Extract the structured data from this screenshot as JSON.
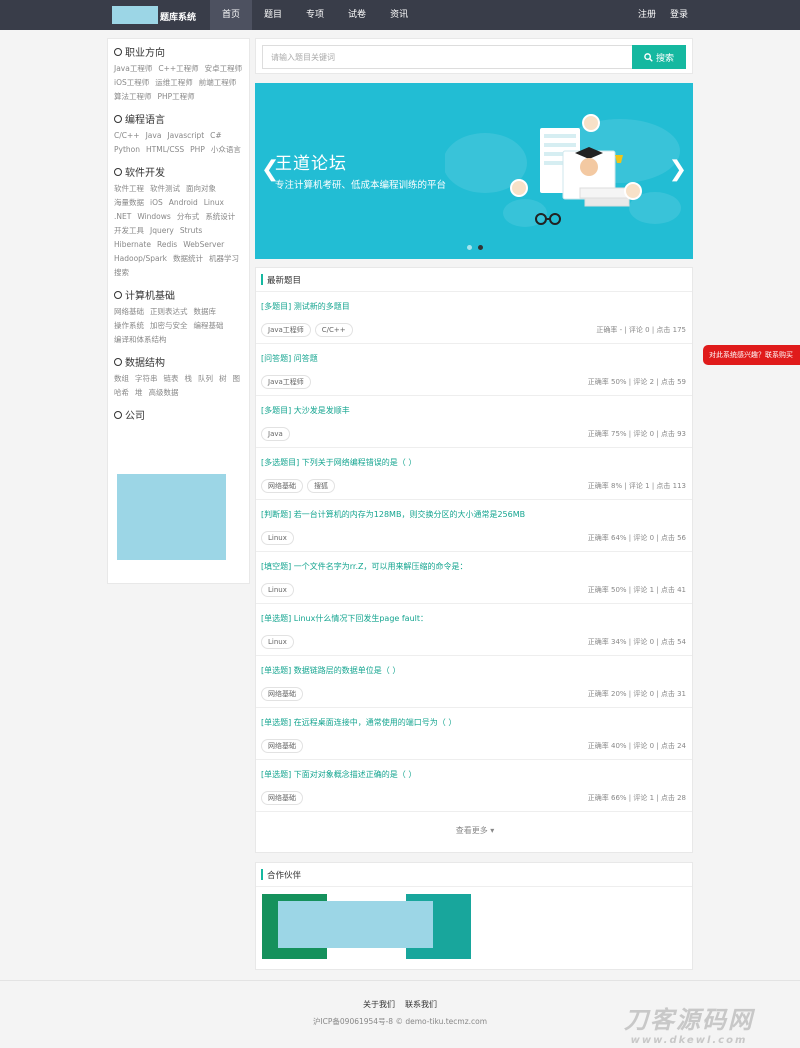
{
  "header": {
    "logo_text": "题库系统",
    "nav": [
      "首页",
      "题目",
      "专项",
      "试卷",
      "资讯"
    ],
    "register": "注册",
    "login": "登录"
  },
  "sidebar": {
    "categories": [
      {
        "title": "职业方向",
        "tags": [
          "Java工程师",
          "C++工程师",
          "安卓工程师",
          "iOS工程师",
          "运维工程师",
          "前端工程师",
          "算法工程师",
          "PHP工程师"
        ]
      },
      {
        "title": "编程语言",
        "tags": [
          "C/C++",
          "Java",
          "Javascript",
          "C#",
          "Python",
          "HTML/CSS",
          "PHP",
          "小众语言"
        ]
      },
      {
        "title": "软件开发",
        "tags": [
          "软件工程",
          "软件测试",
          "面向对象",
          "海量数据",
          "iOS",
          "Android",
          "Linux",
          ".NET",
          "Windows",
          "分布式",
          "系统设计",
          "开发工具",
          "Jquery",
          "Struts",
          "Hibernate",
          "Redis",
          "WebServer",
          "Hadoop/Spark",
          "数据统计",
          "机器学习",
          "搜索"
        ]
      },
      {
        "title": "计算机基础",
        "tags": [
          "网络基础",
          "正则表达式",
          "数据库",
          "操作系统",
          "加密与安全",
          "编程基础",
          "编译和体系结构"
        ]
      },
      {
        "title": "数据结构",
        "tags": [
          "数组",
          "字符串",
          "链表",
          "栈",
          "队列",
          "树",
          "图",
          "哈希",
          "堆",
          "高级数据"
        ]
      },
      {
        "title": "公司",
        "tags": []
      }
    ]
  },
  "search": {
    "placeholder": "请输入题目关键词",
    "button": "搜索"
  },
  "banner": {
    "title": "王道论坛",
    "subtitle": "专注计算机考研、低成本编程训练的平台"
  },
  "questions_section": {
    "title": "最新题目",
    "items": [
      {
        "title": "[多题目] 测试新的多题目",
        "tags": [
          "Java工程师",
          "C/C++"
        ],
        "stats": "正确率 - | 评论 0 | 点击 175"
      },
      {
        "title": "[问答题] 问答题",
        "tags": [
          "Java工程师"
        ],
        "stats": "正确率 50% | 评论 2 | 点击 59"
      },
      {
        "title": "[多题目] 大沙发是发顺丰",
        "tags": [
          "Java"
        ],
        "stats": "正确率 75% | 评论 0 | 点击 93"
      },
      {
        "title": "[多选题目] 下列关于网络编程错误的是（ ）",
        "tags": [
          "网络基础",
          "搜狐"
        ],
        "stats": "正确率 8% | 评论 1 | 点击 113"
      },
      {
        "title": "[判断题] 若一台计算机的内存为128MB，则交换分区的大小通常是256MB",
        "tags": [
          "Linux"
        ],
        "stats": "正确率 64% | 评论 0 | 点击 56"
      },
      {
        "title": "[填空题] 一个文件名字为rr.Z，可以用来解压缩的命令是：",
        "tags": [
          "Linux"
        ],
        "stats": "正确率 50% | 评论 1 | 点击 41"
      },
      {
        "title": "[单选题] Linux什么情况下回发生page fault：",
        "tags": [
          "Linux"
        ],
        "stats": "正确率 34% | 评论 0 | 点击 54"
      },
      {
        "title": "[单选题] 数据链路层的数据单位是（ ）",
        "tags": [
          "网络基础"
        ],
        "stats": "正确率 20% | 评论 0 | 点击 31"
      },
      {
        "title": "[单选题] 在远程桌面连接中，通常使用的端口号为（ ）",
        "tags": [
          "网络基础"
        ],
        "stats": "正确率 40% | 评论 0 | 点击 24"
      },
      {
        "title": "[单选题] 下面对对象概念描述正确的是（ ）",
        "tags": [
          "网络基础"
        ],
        "stats": "正确率 66% | 评论 1 | 点击 28"
      }
    ],
    "more": "查看更多 ▾"
  },
  "partners": {
    "title": "合作伙伴"
  },
  "footer": {
    "links": [
      "关于我们",
      "联系我们"
    ],
    "copyright": "沪ICP备09061954号-8 © demo-tiku.tecmz.com"
  },
  "watermark": {
    "main": "刀客源码网",
    "url": "www.dkewl.com"
  },
  "float_ad": "对此系统感兴趣？联系购买",
  "colors": {
    "accent": "#15b8a0",
    "topbar": "#393d49",
    "banner": "#22bdd4",
    "ad": "#e01b1b"
  }
}
